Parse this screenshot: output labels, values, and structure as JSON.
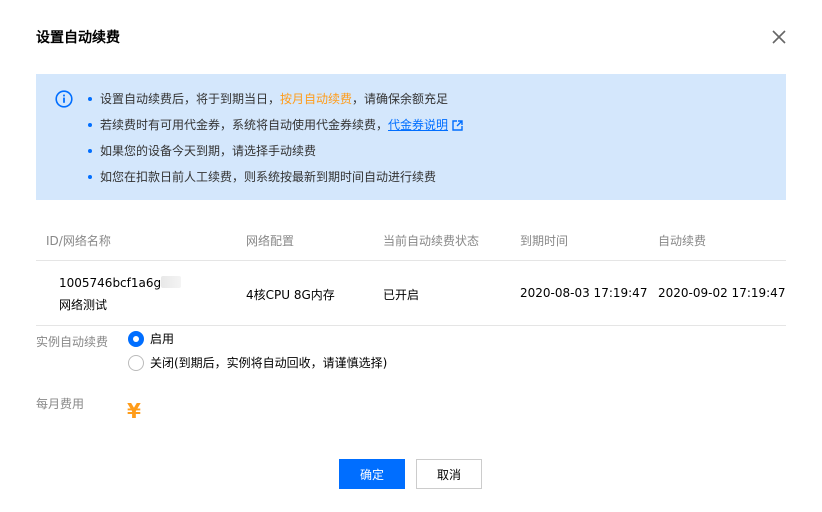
{
  "dialog": {
    "title": "设置自动续费",
    "close_icon": "close-icon"
  },
  "notice": {
    "icon": "info-icon",
    "line1_prefix": "设置自动续费后，将于到期当日，",
    "line1_highlight": "按月自动续费",
    "line1_suffix": "，请确保余额充足",
    "line2_prefix": "若续费时有可用代金券，系统将自动使用代金券续费，",
    "line2_link": "代金券说明",
    "line3": "如果您的设备今天到期，请选择手动续费",
    "line4": "如您在扣款日前人工续费，则系统按最新到期时间自动进行续费"
  },
  "table": {
    "headers": [
      "ID/网络名称",
      "网络配置",
      "当前自动续费状态",
      "到期时间",
      "自动续费"
    ],
    "rows": [
      {
        "id": "1005746bcf1a6g",
        "name": "网络测试",
        "config": "4核CPU 8G内存",
        "status": "已开启",
        "expire": "2020-08-03 17:19:47",
        "auto_renew": "2020-09-02 17:19:47"
      }
    ]
  },
  "form": {
    "renew_label": "实例自动续费",
    "option_enable": "启用",
    "option_disable": "关闭(到期后，实例将自动回收，请谨慎选择)",
    "selected": "启用",
    "fee_label": "每月费用",
    "fee_symbol": "¥"
  },
  "buttons": {
    "confirm": "确定",
    "cancel": "取消"
  },
  "colors": {
    "primary": "#006eff",
    "highlight": "#ff9c19",
    "notice_bg": "#d4e7fc"
  }
}
